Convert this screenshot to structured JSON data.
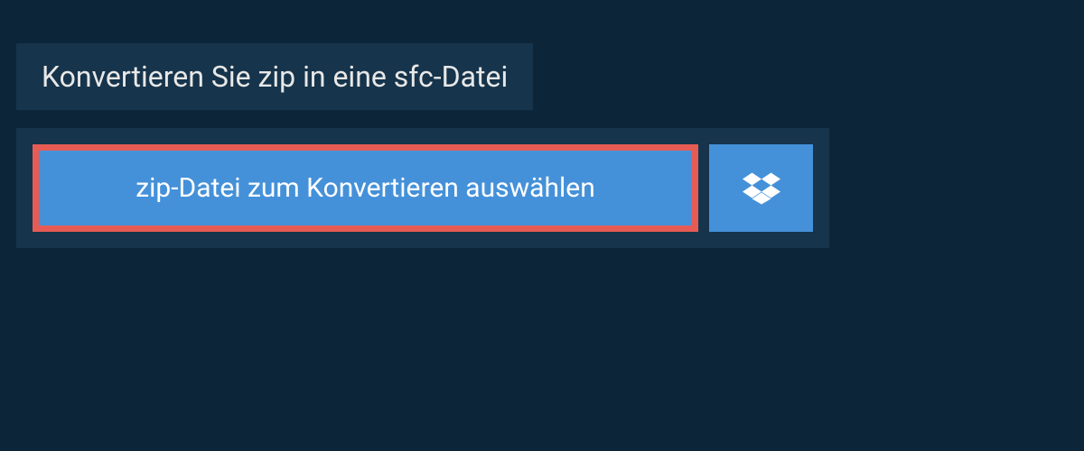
{
  "header": {
    "title": "Konvertieren Sie zip in eine sfc-Datei"
  },
  "upload": {
    "select_label": "zip-Datei zum Konvertieren auswählen",
    "dropbox_icon": "dropbox"
  }
}
